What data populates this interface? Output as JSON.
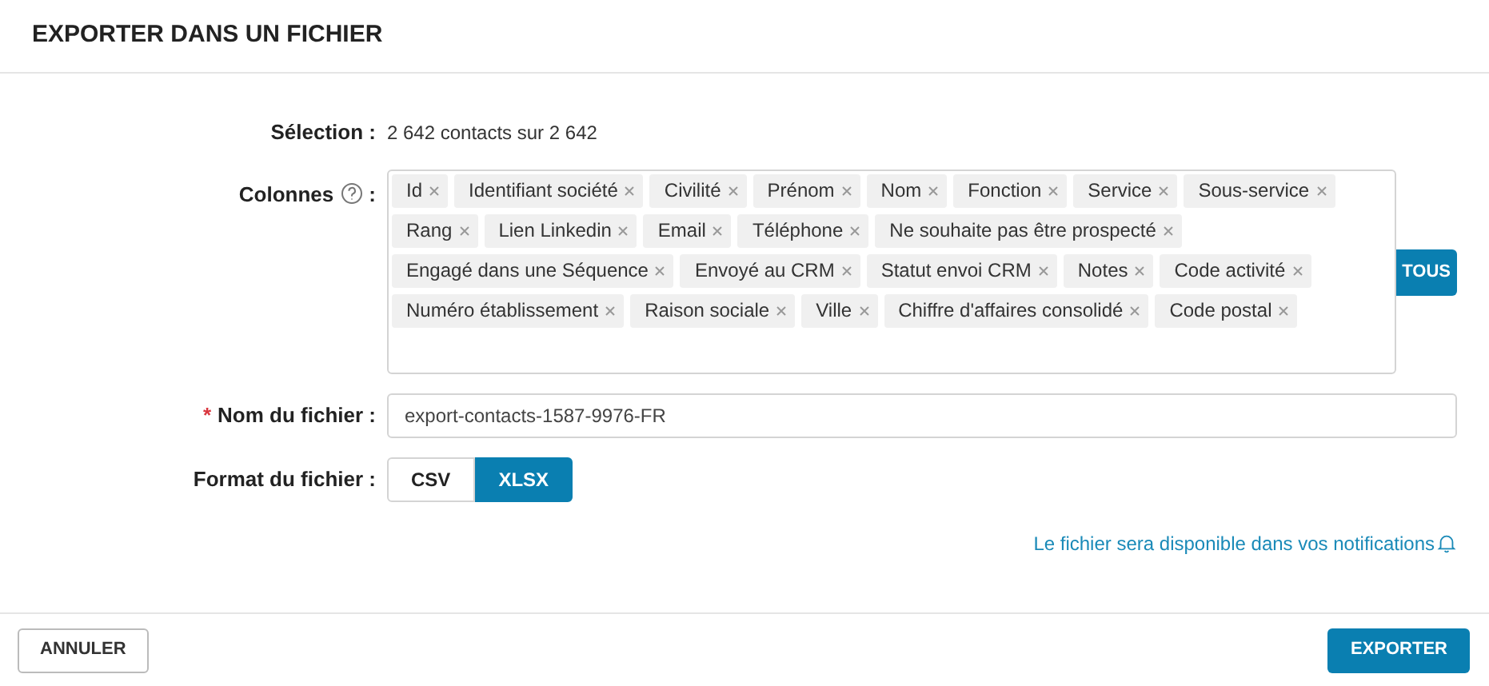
{
  "dialog": {
    "title": "EXPORTER DANS UN FICHIER"
  },
  "selection": {
    "label": "Sélection :",
    "value": "2 642 contacts sur 2 642"
  },
  "columns": {
    "label": "Colonnes",
    "colon": ":",
    "all_button": "TOUS",
    "tags": [
      {
        "label": "Id"
      },
      {
        "label": "Identifiant société"
      },
      {
        "label": "Civilité"
      },
      {
        "label": "Prénom"
      },
      {
        "label": "Nom"
      },
      {
        "label": "Fonction"
      },
      {
        "label": "Service"
      },
      {
        "label": "Sous-service"
      },
      {
        "label": "Rang"
      },
      {
        "label": "Lien Linkedin"
      },
      {
        "label": "Email"
      },
      {
        "label": "Téléphone"
      },
      {
        "label": "Ne souhaite pas être prospecté"
      },
      {
        "label": "Engagé dans une Séquence"
      },
      {
        "label": "Envoyé au CRM"
      },
      {
        "label": "Statut envoi CRM"
      },
      {
        "label": "Notes"
      },
      {
        "label": "Code activité"
      },
      {
        "label": "Numéro établissement"
      },
      {
        "label": "Raison sociale"
      },
      {
        "label": "Ville"
      },
      {
        "label": "Chiffre d'affaires consolidé"
      },
      {
        "label": "Code postal"
      }
    ]
  },
  "file_name": {
    "required_mark": "*",
    "label": "Nom du fichier :",
    "value": "export-contacts-1587-9976-FR"
  },
  "file_format": {
    "label": "Format du fichier :",
    "options": [
      {
        "label": "CSV",
        "selected": false
      },
      {
        "label": "XLSX",
        "selected": true
      }
    ]
  },
  "notice": "Le fichier sera disponible dans vos notifications",
  "buttons": {
    "cancel": "ANNULER",
    "export": "EXPORTER"
  }
}
